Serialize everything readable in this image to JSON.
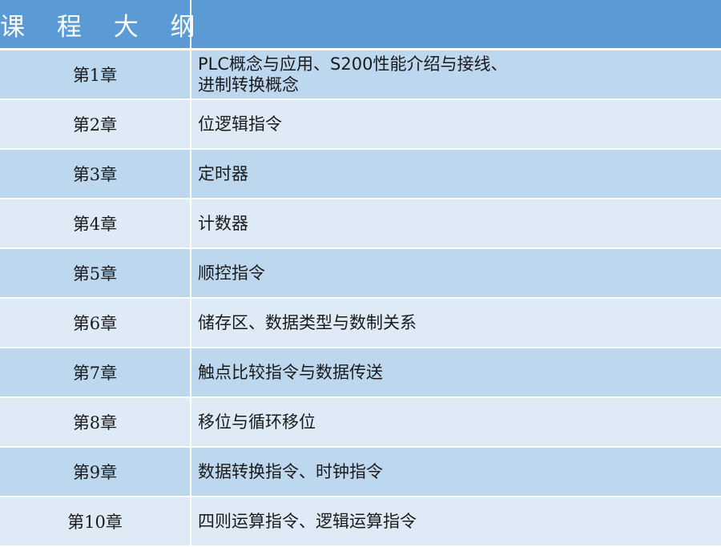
{
  "header": {
    "title": "课 程 大 纲",
    "right": ""
  },
  "chapters": [
    {
      "chapter": "第1章",
      "topic_line1": "PLC概念与应用、S200性能介绍与接线、",
      "topic_line2": "进制转换概念"
    },
    {
      "chapter": "第2章",
      "topic": "位逻辑指令"
    },
    {
      "chapter": "第3章",
      "topic": "定时器"
    },
    {
      "chapter": "第4章",
      "topic": "计数器"
    },
    {
      "chapter": "第5章",
      "topic": "顺控指令"
    },
    {
      "chapter": "第6章",
      "topic": "储存区、数据类型与数制关系"
    },
    {
      "chapter": "第7章",
      "topic": "触点比较指令与数据传送"
    },
    {
      "chapter": "第8章",
      "topic": "移位与循环移位"
    },
    {
      "chapter": "第9章",
      "topic": "数据转换指令、时钟指令"
    },
    {
      "chapter": "第10章",
      "topic": "四则运算指令、逻辑运算指令"
    }
  ],
  "colors": {
    "header_bg": "#5b9bd5",
    "row_dark": "#bdd7ee",
    "row_light": "#deebf7",
    "text": "#1a1a1a"
  }
}
